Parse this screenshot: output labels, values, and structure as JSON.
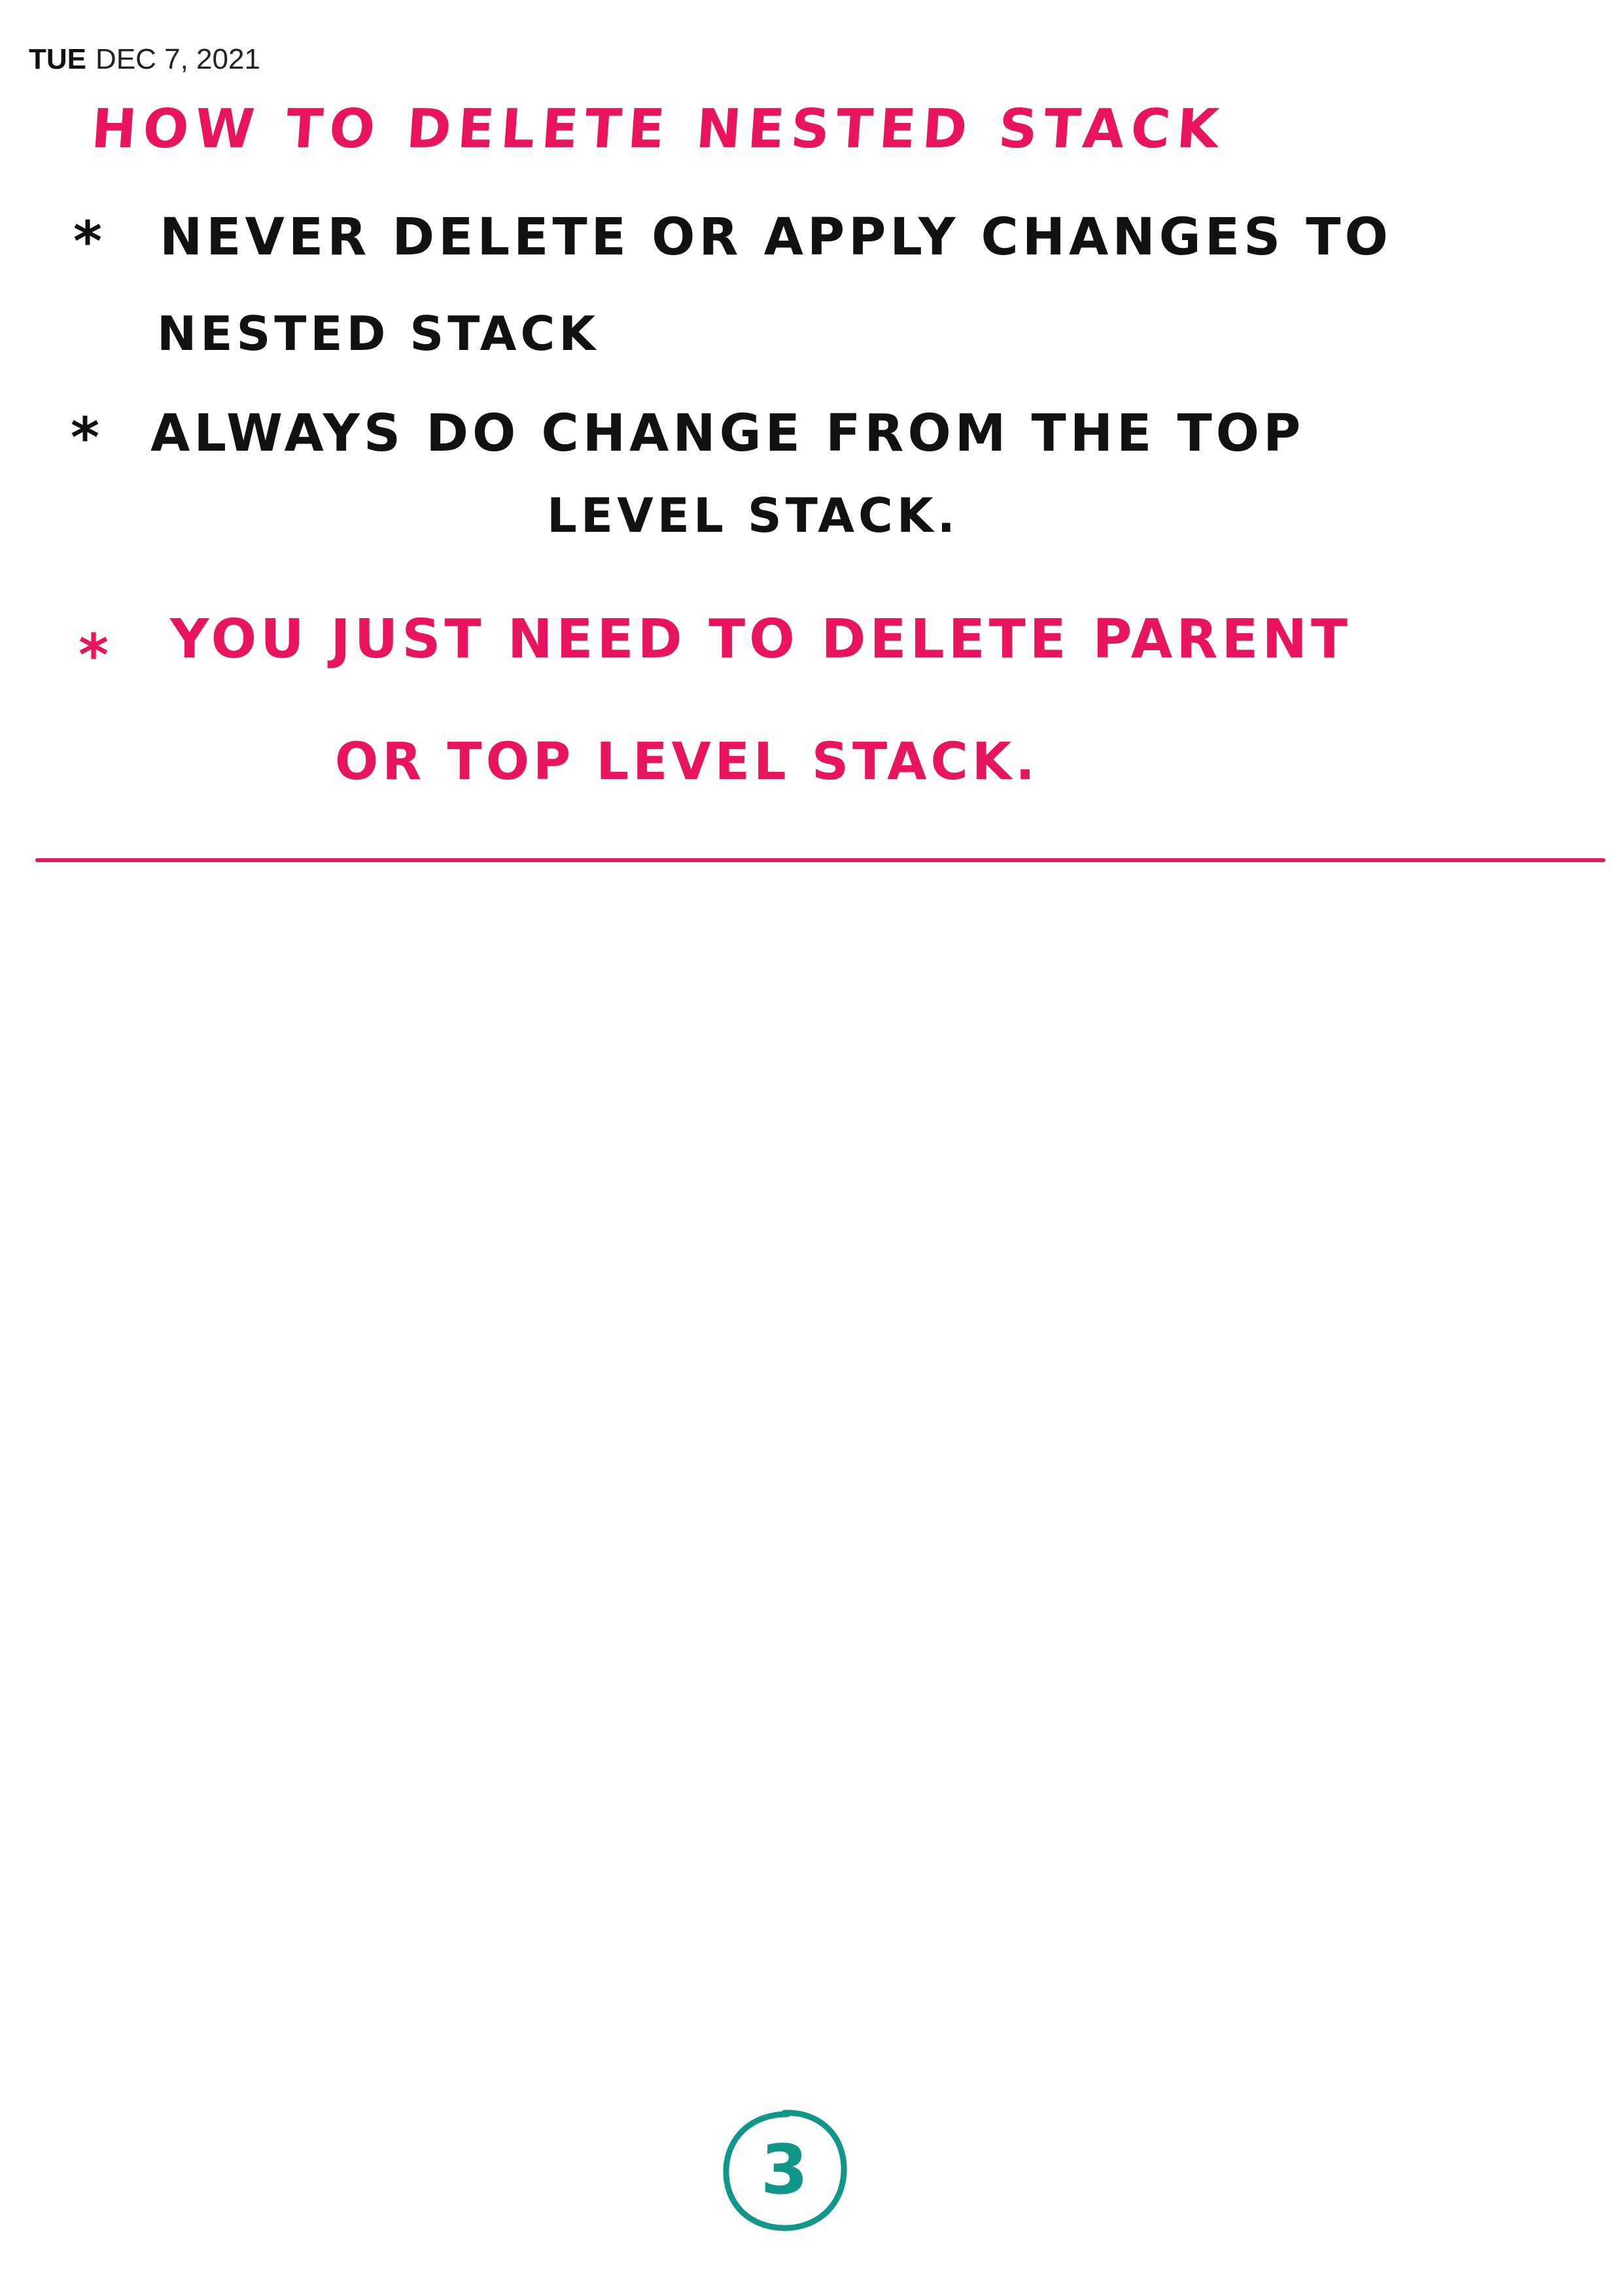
{
  "header": {
    "day": "TUE",
    "date": "DEC 7, 2021"
  },
  "note": {
    "title": "HOW TO DELETE NESTED STACK",
    "bullets": [
      {
        "marker": "*",
        "line1": "NEVER DELETE OR APPLY CHANGES TO",
        "line2": "NESTED STACK",
        "color": "#111111"
      },
      {
        "marker": "*",
        "line1": "ALWAYS DO CHANGE FROM THE TOP",
        "line2": "LEVEL STACK.",
        "color": "#111111"
      },
      {
        "marker": "*",
        "line1": "YOU JUST NEED TO DELETE PARENT",
        "line2": "OR TOP LEVEL STACK.",
        "color": "#e8145e"
      }
    ]
  },
  "footer": {
    "page_number": "3"
  },
  "colors": {
    "accent": "#e8145e",
    "ink": "#111111",
    "page_number": "#11968a"
  }
}
